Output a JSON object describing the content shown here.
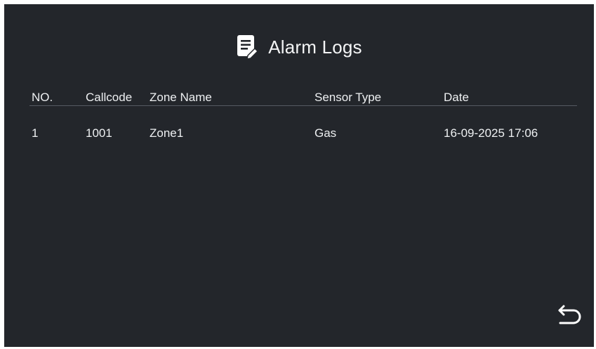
{
  "header": {
    "title": "Alarm Logs",
    "icon": "notepad-icon"
  },
  "table": {
    "columns": [
      "NO.",
      "Callcode",
      "Zone Name",
      "Sensor Type",
      "Date"
    ],
    "rows": [
      {
        "no": "1",
        "callcode": "1001",
        "zone_name": "Zone1",
        "sensor_type": "Gas",
        "date": "16-09-2025 17:06"
      }
    ]
  },
  "footer": {
    "back_icon": "back-arrow-icon"
  },
  "colors": {
    "background": "#23262b",
    "text": "#eef0f2",
    "divider": "#555a62"
  }
}
